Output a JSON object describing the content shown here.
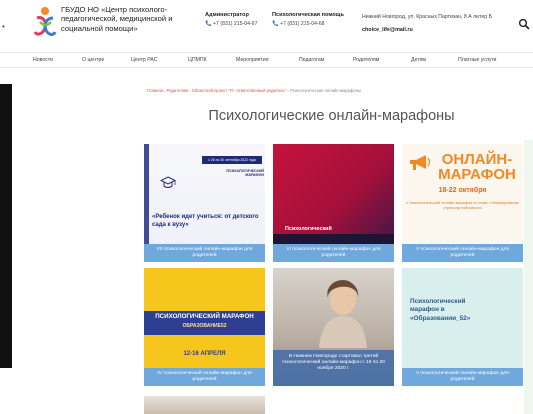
{
  "header": {
    "org_name": "ГБУДО НО «Центр психолого-педагогической, медицинской и социальной помощи»",
    "admin": {
      "title": "Администратор",
      "phone": "+7 (831) 215-04-67"
    },
    "help": {
      "title": "Психологическая помощь",
      "phone": "+7 (831) 215-04-68"
    },
    "address": "Нижний Новгород, ул. Красных Партизан, 8 А литер Б",
    "email": "choice_life@mail.ru"
  },
  "nav": {
    "items": [
      "Новости",
      "О центре",
      "Центр РАС",
      "ЦПМПК",
      "Мероприятия",
      "Педагогам",
      "Родителям",
      "Детям",
      "Платные услуги"
    ]
  },
  "breadcrumb": {
    "home": "Главная",
    "parents": "Родителям",
    "project": "Областной проект \"Я - ответственный родитель\"",
    "current": "Психологические онлайн-марафоны"
  },
  "page": {
    "title": "Психологические онлайн-марафоны"
  },
  "cards": [
    {
      "caption": "VII психологический онлайн-марафон для родителей",
      "badge": "с 26 по 30 сентября 2022 года",
      "sub": "ПСИХОЛОГИЧЕСКИЙ МАРАФОН",
      "quote": "«Ребенок идет учиться: от детского сада к вузу»"
    },
    {
      "caption": "VI психологический онлайн-марафон для родителей",
      "label": "Психологический"
    },
    {
      "caption": "V психологический онлайн-марафон для родителей",
      "big": "ОНЛАЙН-МАРАФОН",
      "date": "18-22 октября",
      "text": "V психологический онлайн-марафон по теме: «Формирование стрессоустойчивости"
    },
    {
      "caption": "IV психологический онлайн-марафон для родителей",
      "heading": "ПСИХОЛОГИЧЕСКИЙ МАРАФОН",
      "heading2": "ОБРАЗОВАНИЕ52",
      "date": "12-16 АПРЕЛЯ"
    },
    {
      "caption": "В Нижнем Новгороде стартовал третий психологический онлайн-марафон с 16 по 20 ноября 2020 г."
    },
    {
      "caption": "II психологический онлайн-марафон для родителей",
      "text": "Психологический марафон в «Образовании_52»"
    }
  ],
  "colors": {
    "caption_blue": "#6fa8dc",
    "accent_red": "#e05050",
    "marathon_orange": "#f08a24"
  }
}
